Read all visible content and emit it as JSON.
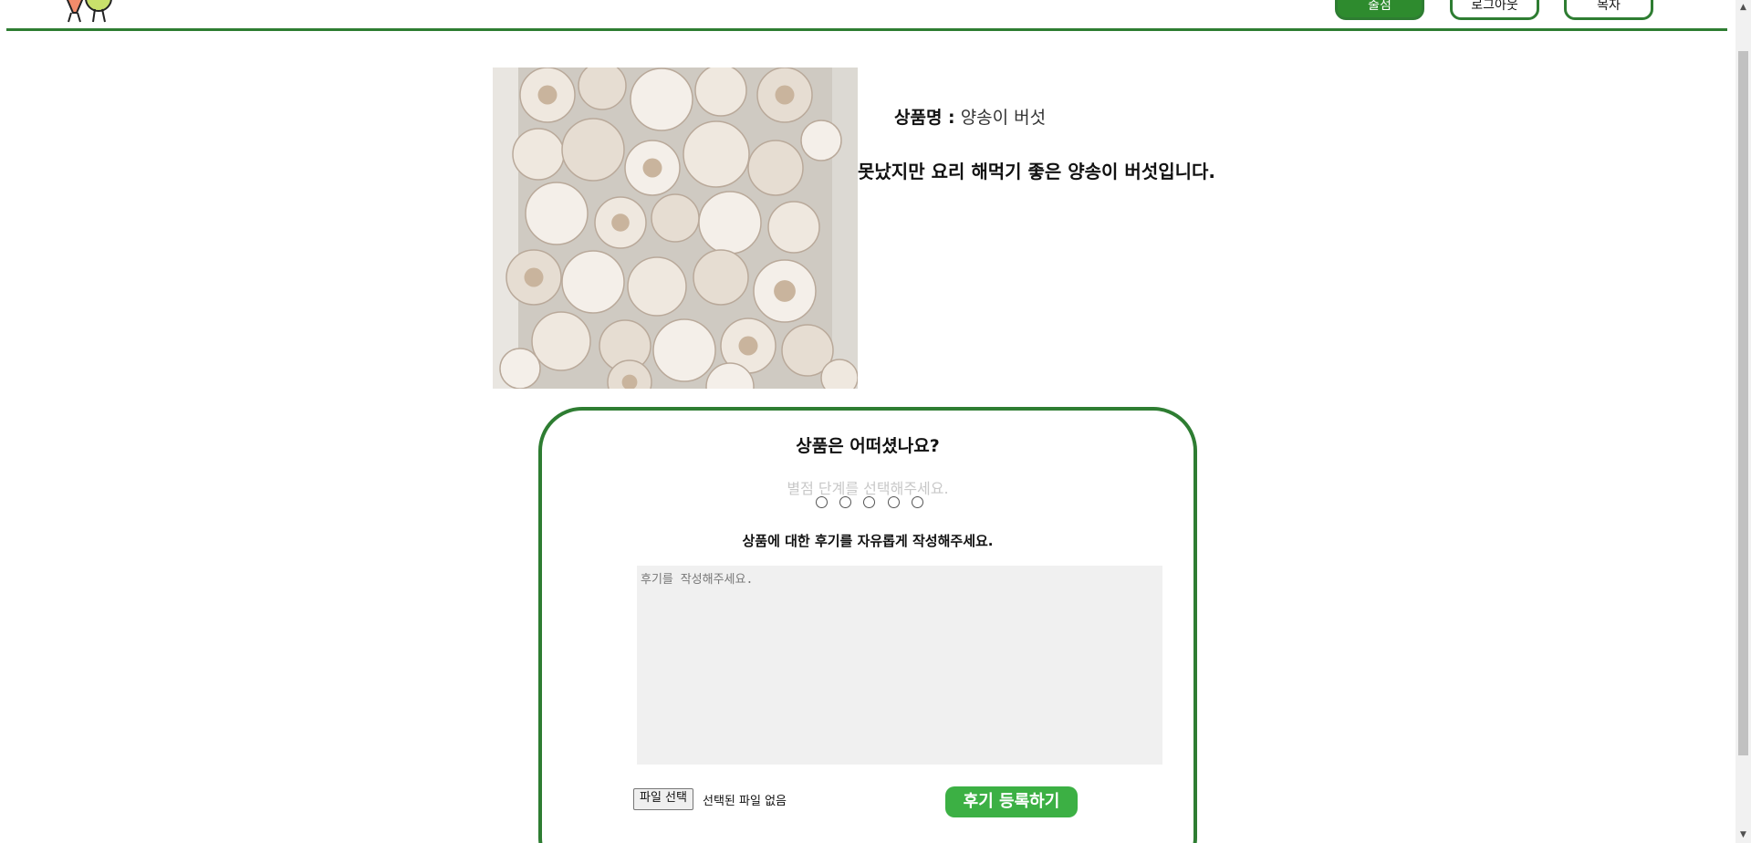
{
  "header": {
    "nav_buttons": [
      {
        "label": "출점"
      },
      {
        "label": "로그아웃"
      },
      {
        "label": "목자"
      }
    ]
  },
  "product": {
    "name_label": "상품명 :",
    "name_value": "양송이 버섯",
    "description": "못났지만 요리 해먹기 좋은 양송이 버섯입니다."
  },
  "review": {
    "title": "상품은 어떠셨나요?",
    "rating_hint": "별점 단계를 선택해주세요.",
    "rating_options": 5,
    "instruction": "상품에 대한 후기를 자유롭게 작성해주세요.",
    "textarea_placeholder": "후기를 작성해주세요.",
    "file_button_label": "파일 선택",
    "file_status": "선택된 파일 없음",
    "submit_label": "후기 등록하기"
  },
  "colors": {
    "accent_green": "#2e7d32",
    "submit_green": "#3cb044"
  }
}
